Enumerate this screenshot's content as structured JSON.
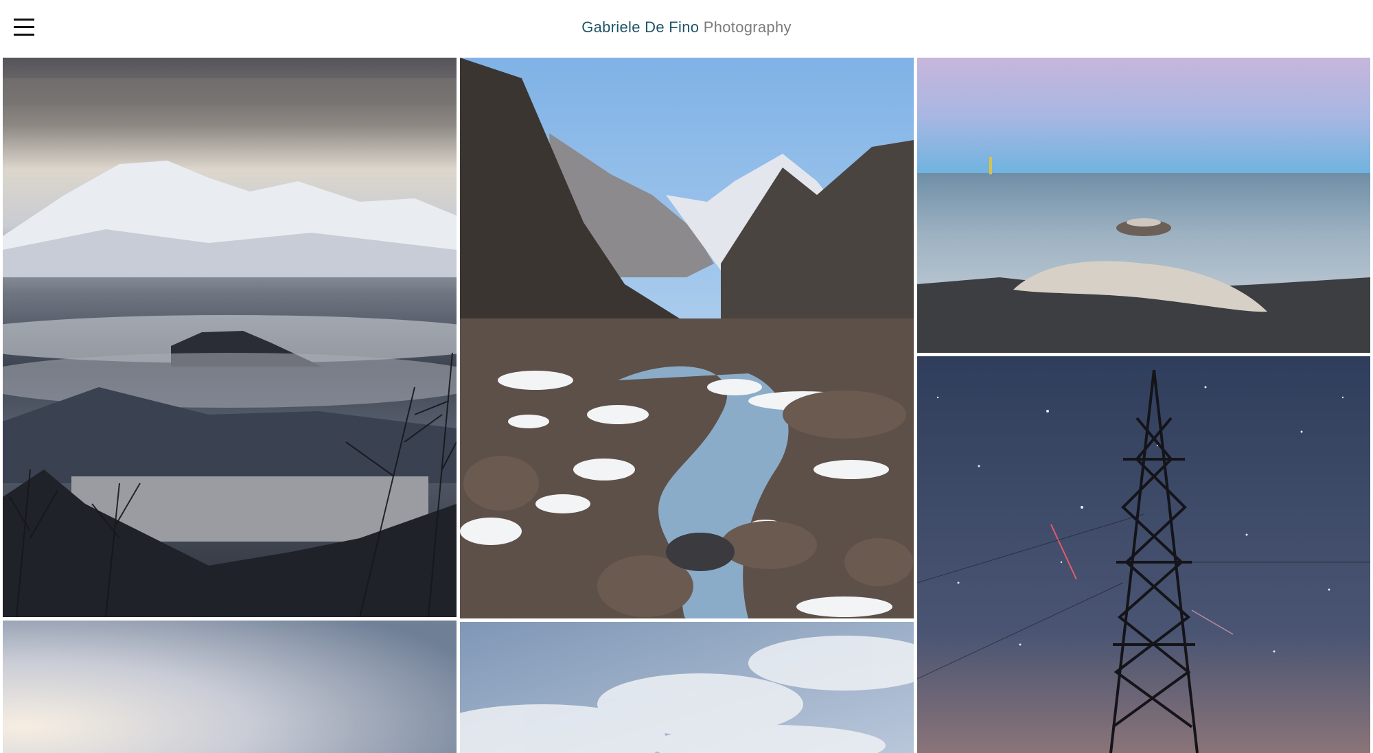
{
  "header": {
    "title_name": "Gabriele De Fino",
    "title_suffix": "Photography",
    "menu_icon": "hamburger-menu-icon"
  },
  "colors": {
    "title_name": "#1f5466",
    "title_suffix": "#7b7b7b",
    "background": "#ffffff"
  },
  "gallery": {
    "photos": [
      {
        "subject": "mountain-lake-sunrise"
      },
      {
        "subject": "snowy-mountain-stream"
      },
      {
        "subject": "seashore-long-exposure"
      },
      {
        "subject": "pylon-starry-night"
      },
      {
        "subject": "misty-water-surface"
      },
      {
        "subject": "cloudy-sky"
      }
    ]
  }
}
